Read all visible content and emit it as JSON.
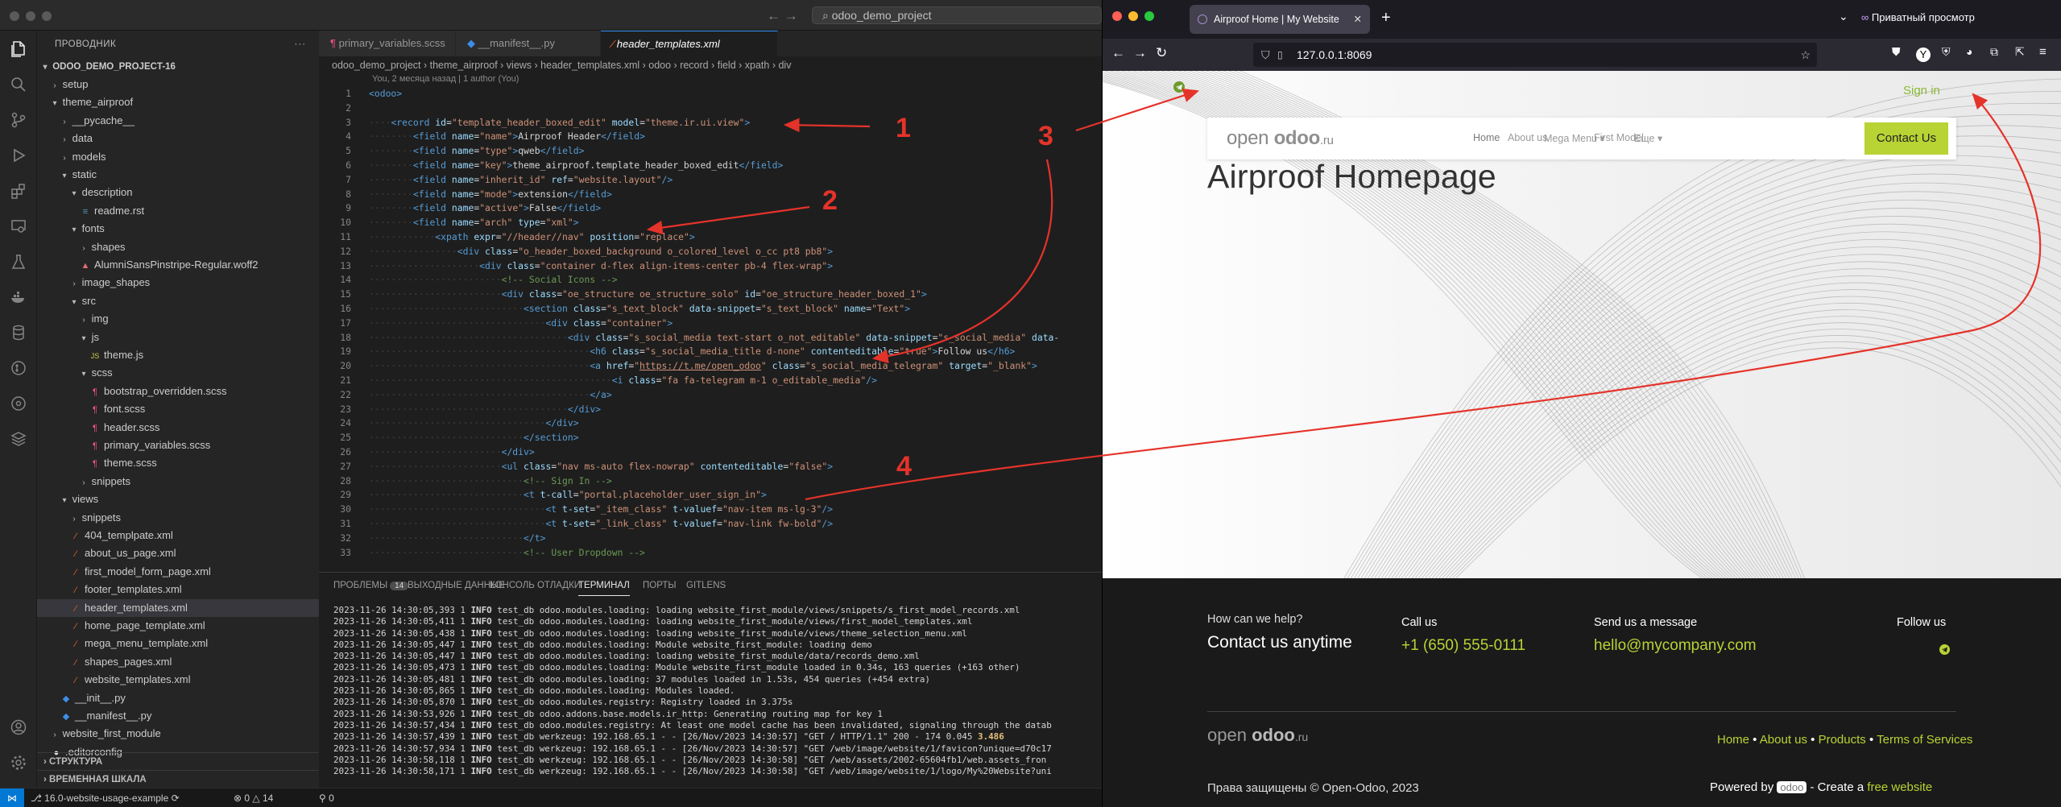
{
  "vscode": {
    "nav_arrows": "← →",
    "search_text": "odoo_demo_project",
    "explorer_title": "ПРОВОДНИК",
    "project": "ODOO_DEMO_PROJECT-16",
    "tree": [
      {
        "label": "setup",
        "indent": 1,
        "kind": "folder",
        "open": false
      },
      {
        "label": "theme_airproof",
        "indent": 1,
        "kind": "folder",
        "open": true
      },
      {
        "label": "__pycache__",
        "indent": 2,
        "kind": "folder",
        "open": false
      },
      {
        "label": "data",
        "indent": 2,
        "kind": "folder",
        "open": false
      },
      {
        "label": "models",
        "indent": 2,
        "kind": "folder",
        "open": false
      },
      {
        "label": "static",
        "indent": 2,
        "kind": "folder",
        "open": true
      },
      {
        "label": "description",
        "indent": 3,
        "kind": "folder",
        "open": true
      },
      {
        "label": "readme.rst",
        "indent": 4,
        "kind": "rst"
      },
      {
        "label": "fonts",
        "indent": 3,
        "kind": "folder",
        "open": true
      },
      {
        "label": "shapes",
        "indent": 4,
        "kind": "folder",
        "open": false
      },
      {
        "label": "AlumniSansPinstripe-Regular.woff2",
        "indent": 4,
        "kind": "font"
      },
      {
        "label": "image_shapes",
        "indent": 3,
        "kind": "folder",
        "open": false
      },
      {
        "label": "src",
        "indent": 3,
        "kind": "folder",
        "open": true
      },
      {
        "label": "img",
        "indent": 4,
        "kind": "folder",
        "open": false
      },
      {
        "label": "js",
        "indent": 4,
        "kind": "folder",
        "open": true
      },
      {
        "label": "theme.js",
        "indent": 5,
        "kind": "js"
      },
      {
        "label": "scss",
        "indent": 4,
        "kind": "folder",
        "open": true
      },
      {
        "label": "bootstrap_overridden.scss",
        "indent": 5,
        "kind": "scss"
      },
      {
        "label": "font.scss",
        "indent": 5,
        "kind": "scss"
      },
      {
        "label": "header.scss",
        "indent": 5,
        "kind": "scss"
      },
      {
        "label": "primary_variables.scss",
        "indent": 5,
        "kind": "scss"
      },
      {
        "label": "theme.scss",
        "indent": 5,
        "kind": "scss"
      },
      {
        "label": "snippets",
        "indent": 4,
        "kind": "folder",
        "open": false
      },
      {
        "label": "views",
        "indent": 2,
        "kind": "folder",
        "open": true
      },
      {
        "label": "snippets",
        "indent": 3,
        "kind": "folder",
        "open": false
      },
      {
        "label": "404_templpate.xml",
        "indent": 3,
        "kind": "xml"
      },
      {
        "label": "about_us_page.xml",
        "indent": 3,
        "kind": "xml"
      },
      {
        "label": "first_model_form_page.xml",
        "indent": 3,
        "kind": "xml"
      },
      {
        "label": "footer_templates.xml",
        "indent": 3,
        "kind": "xml"
      },
      {
        "label": "header_templates.xml",
        "indent": 3,
        "kind": "xml",
        "selected": true
      },
      {
        "label": "home_page_template.xml",
        "indent": 3,
        "kind": "xml"
      },
      {
        "label": "mega_menu_template.xml",
        "indent": 3,
        "kind": "xml"
      },
      {
        "label": "shapes_pages.xml",
        "indent": 3,
        "kind": "xml"
      },
      {
        "label": "website_templates.xml",
        "indent": 3,
        "kind": "xml"
      },
      {
        "label": "__init__.py",
        "indent": 2,
        "kind": "py"
      },
      {
        "label": "__manifest__.py",
        "indent": 2,
        "kind": "py"
      },
      {
        "label": "website_first_module",
        "indent": 1,
        "kind": "folder",
        "open": false
      },
      {
        "label": ".editorconfig",
        "indent": 1,
        "kind": "cfg"
      }
    ],
    "outline_label": "СТРУКТУРА",
    "timeline_label": "ВРЕМЕННАЯ ШКАЛА",
    "tabs": [
      {
        "label": "primary_variables.scss",
        "icon": "¶",
        "iconColor": "#f55385",
        "active": false
      },
      {
        "label": "__manifest__.py",
        "icon": "◆",
        "iconColor": "#3b8eea",
        "active": false
      },
      {
        "label": "header_templates.xml",
        "icon": "⁄",
        "iconColor": "#f1662a",
        "active": true
      }
    ],
    "breadcrumbs": [
      "odoo_demo_project",
      "theme_airproof",
      "views",
      "header_templates.xml",
      "odoo",
      "record",
      "field",
      "xpath",
      "div"
    ],
    "blame": "You, 2 месяца назад | 1 author (You)",
    "code": [
      {
        "n": "1",
        "d": 0,
        "h": "<span class=t>&lt;odoo&gt;</span>"
      },
      {
        "n": "2",
        "d": 0,
        "h": ""
      },
      {
        "n": "3",
        "d": 1,
        "h": "<span class=t>&lt;record</span> <span class=a>id</span><span class=w>=</span><span class=s>\"template_header_boxed_edit\"</span> <span class=a>model</span><span class=w>=</span><span class=s>\"theme.ir.ui.view\"</span><span class=t>&gt;</span>"
      },
      {
        "n": "4",
        "d": 2,
        "h": "<span class=t>&lt;field</span> <span class=a>name</span><span class=w>=</span><span class=s>\"name\"</span><span class=t>&gt;</span><span class=w>Airproof Header</span><span class=t>&lt;/field&gt;</span>"
      },
      {
        "n": "5",
        "d": 2,
        "h": "<span class=t>&lt;field</span> <span class=a>name</span><span class=w>=</span><span class=s>\"type\"</span><span class=t>&gt;</span><span class=w>qweb</span><span class=t>&lt;/field&gt;</span>"
      },
      {
        "n": "6",
        "d": 2,
        "h": "<span class=t>&lt;field</span> <span class=a>name</span><span class=w>=</span><span class=s>\"key\"</span><span class=t>&gt;</span><span class=w>theme_airproof.template_header_boxed_edit</span><span class=t>&lt;/field&gt;</span>"
      },
      {
        "n": "7",
        "d": 2,
        "h": "<span class=t>&lt;field</span> <span class=a>name</span><span class=w>=</span><span class=s>\"inherit_id\"</span> <span class=a>ref</span><span class=w>=</span><span class=s>\"website.layout\"</span><span class=t>/&gt;</span>"
      },
      {
        "n": "8",
        "d": 2,
        "h": "<span class=t>&lt;field</span> <span class=a>name</span><span class=w>=</span><span class=s>\"mode\"</span><span class=t>&gt;</span><span class=w>extension</span><span class=t>&lt;/field&gt;</span>"
      },
      {
        "n": "9",
        "d": 2,
        "h": "<span class=t>&lt;field</span> <span class=a>name</span><span class=w>=</span><span class=s>\"active\"</span><span class=t>&gt;</span><span class=w>False</span><span class=t>&lt;/field&gt;</span>"
      },
      {
        "n": "10",
        "d": 2,
        "h": "<span class=t>&lt;field</span> <span class=a>name</span><span class=w>=</span><span class=s>\"arch\"</span> <span class=a>type</span><span class=w>=</span><span class=s>\"xml\"</span><span class=t>&gt;</span>"
      },
      {
        "n": "11",
        "d": 3,
        "h": "<span class=t>&lt;xpath</span> <span class=a>expr</span><span class=w>=</span><span class=s>\"//header//nav\"</span> <span class=a>position</span><span class=w>=</span><span class=s>\"replace\"</span><span class=t>&gt;</span>"
      },
      {
        "n": "12",
        "d": 4,
        "h": "<span class=t>&lt;div</span> <span class=a>class</span><span class=w>=</span><span class=s>\"o_header_boxed_background o_colored_level o_cc pt8 pb8\"</span><span class=t>&gt;</span>"
      },
      {
        "n": "13",
        "d": 5,
        "h": "<span class=t>&lt;div</span> <span class=a>class</span><span class=w>=</span><span class=s>\"container d-flex align-items-center pb-4 flex-wrap\"</span><span class=t>&gt;</span>"
      },
      {
        "n": "14",
        "d": 6,
        "h": "<span class=c>&lt;!-- Social Icons --&gt;</span>"
      },
      {
        "n": "15",
        "d": 6,
        "h": "<span class=t>&lt;div</span> <span class=a>class</span><span class=w>=</span><span class=s>\"oe_structure oe_structure_solo\"</span> <span class=a>id</span><span class=w>=</span><span class=s>\"oe_structure_header_boxed_1\"</span><span class=t>&gt;</span>"
      },
      {
        "n": "16",
        "d": 7,
        "h": "<span class=t>&lt;section</span> <span class=a>class</span><span class=w>=</span><span class=s>\"s_text_block\"</span> <span class=a>data-snippet</span><span class=w>=</span><span class=s>\"s_text_block\"</span> <span class=a>name</span><span class=w>=</span><span class=s>\"Text\"</span><span class=t>&gt;</span>"
      },
      {
        "n": "17",
        "d": 8,
        "h": "<span class=t>&lt;div</span> <span class=a>class</span><span class=w>=</span><span class=s>\"container\"</span><span class=t>&gt;</span>"
      },
      {
        "n": "18",
        "d": 9,
        "h": "<span class=t>&lt;div</span> <span class=a>class</span><span class=w>=</span><span class=s>\"s_social_media text-start o_not_editable\"</span> <span class=a>data-snippet</span><span class=w>=</span><span class=s>\"s_social_media\"</span> <span class=a>data-</span>"
      },
      {
        "n": "19",
        "d": 10,
        "h": "<span class=t>&lt;h6</span> <span class=a>class</span><span class=w>=</span><span class=s>\"s_social_media_title d-none\"</span> <span class=a>contenteditable</span><span class=w>=</span><span class=s>\"true\"</span><span class=t>&gt;</span><span class=w>Follow us</span><span class=t>&lt;/h6&gt;</span>"
      },
      {
        "n": "20",
        "d": 10,
        "h": "<span class=t>&lt;a</span> <span class=a>href</span><span class=w>=</span><span class=s>\"<u>https://t.me/open_odoo</u>\"</span> <span class=a>class</span><span class=w>=</span><span class=s>\"s_social_media_telegram\"</span> <span class=a>target</span><span class=w>=</span><span class=s>\"_blank\"</span><span class=t>&gt;</span>"
      },
      {
        "n": "21",
        "d": 11,
        "h": "<span class=t>&lt;i</span> <span class=a>class</span><span class=w>=</span><span class=s>\"fa fa-telegram m-1 o_editable_media\"</span><span class=t>/&gt;</span>"
      },
      {
        "n": "22",
        "d": 10,
        "h": "<span class=t>&lt;/a&gt;</span>"
      },
      {
        "n": "23",
        "d": 9,
        "h": "<span class=t>&lt;/div&gt;</span>"
      },
      {
        "n": "24",
        "d": 8,
        "h": "<span class=t>&lt;/div&gt;</span>"
      },
      {
        "n": "25",
        "d": 7,
        "h": "<span class=t>&lt;/section&gt;</span>"
      },
      {
        "n": "26",
        "d": 6,
        "h": "<span class=t>&lt;/div&gt;</span>"
      },
      {
        "n": "27",
        "d": 6,
        "h": "<span class=t>&lt;ul</span> <span class=a>class</span><span class=w>=</span><span class=s>\"nav ms-auto flex-nowrap\"</span> <span class=a>contenteditable</span><span class=w>=</span><span class=s>\"false\"</span><span class=t>&gt;</span>"
      },
      {
        "n": "28",
        "d": 7,
        "h": "<span class=c>&lt;!-- Sign In --&gt;</span>"
      },
      {
        "n": "29",
        "d": 7,
        "h": "<span class=t>&lt;t</span> <span class=a>t-call</span><span class=w>=</span><span class=s>\"portal.placeholder_user_sign_in\"</span><span class=t>&gt;</span>"
      },
      {
        "n": "30",
        "d": 8,
        "h": "<span class=t>&lt;t</span> <span class=a>t-set</span><span class=w>=</span><span class=s>\"_item_class\"</span> <span class=a>t-valuef</span><span class=w>=</span><span class=s>\"nav-item ms-lg-3\"</span><span class=t>/&gt;</span>"
      },
      {
        "n": "31",
        "d": 8,
        "h": "<span class=t>&lt;t</span> <span class=a>t-set</span><span class=w>=</span><span class=s>\"_link_class\"</span> <span class=a>t-valuef</span><span class=w>=</span><span class=s>\"nav-link fw-bold\"</span><span class=t>/&gt;</span>"
      },
      {
        "n": "32",
        "d": 7,
        "h": "<span class=t>&lt;/t&gt;</span>"
      },
      {
        "n": "33",
        "d": 7,
        "h": "<span class=c>&lt;!-- User Dropdown --&gt;</span>"
      }
    ],
    "panel_tabs": [
      "ПРОБЛЕМЫ",
      "ВЫХОДНЫЕ ДАННЫЕ",
      "КОНСОЛЬ ОТЛАДКИ",
      "ТЕРМИНАЛ",
      "ПОРТЫ",
      "GITLENS"
    ],
    "problems_count": "14",
    "terminal": [
      {
        "ts": "2023-11-26 14:30:05,393",
        "pid": "1",
        "lvl": "INFO",
        "msg": "test_db odoo.modules.loading: loading website_first_module/views/snippets/s_first_model_records.xml"
      },
      {
        "ts": "2023-11-26 14:30:05,411",
        "pid": "1",
        "lvl": "INFO",
        "msg": "test_db odoo.modules.loading: loading website_first_module/views/first_model_templates.xml"
      },
      {
        "ts": "2023-11-26 14:30:05,438",
        "pid": "1",
        "lvl": "INFO",
        "msg": "test_db odoo.modules.loading: loading website_first_module/views/theme_selection_menu.xml"
      },
      {
        "ts": "2023-11-26 14:30:05,447",
        "pid": "1",
        "lvl": "INFO",
        "msg": "test_db odoo.modules.loading: Module website_first_module: loading demo"
      },
      {
        "ts": "2023-11-26 14:30:05,447",
        "pid": "1",
        "lvl": "INFO",
        "msg": "test_db odoo.modules.loading: loading website_first_module/data/records_demo.xml"
      },
      {
        "ts": "2023-11-26 14:30:05,473",
        "pid": "1",
        "lvl": "INFO",
        "msg": "test_db odoo.modules.loading: Module website_first_module loaded in 0.34s, 163 queries (+163 other)"
      },
      {
        "ts": "2023-11-26 14:30:05,481",
        "pid": "1",
        "lvl": "INFO",
        "msg": "test_db odoo.modules.loading: 37 modules loaded in 1.53s, 454 queries (+454 extra)"
      },
      {
        "ts": "2023-11-26 14:30:05,865",
        "pid": "1",
        "lvl": "INFO",
        "msg": "test_db odoo.modules.loading: Modules loaded."
      },
      {
        "ts": "2023-11-26 14:30:05,870",
        "pid": "1",
        "lvl": "INFO",
        "msg": "test_db odoo.modules.registry: Registry loaded in 3.375s"
      },
      {
        "ts": "2023-11-26 14:30:53,926",
        "pid": "1",
        "lvl": "INFO",
        "msg": "test_db odoo.addons.base.models.ir_http: Generating routing map for key 1"
      },
      {
        "ts": "2023-11-26 14:30:57,434",
        "pid": "1",
        "lvl": "INFO",
        "msg": "test_db odoo.modules.registry: At least one model cache has been invalidated, signaling through the datab"
      },
      {
        "ts": "2023-11-26 14:30:57,439",
        "pid": "1",
        "lvl": "INFO",
        "msg": "test_db werkzeug: 192.168.65.1 - - [26/Nov/2023 14:30:57] \"GET / HTTP/1.1\" 200 - ",
        "tail": [
          "174",
          "0.045",
          "3.486"
        ]
      },
      {
        "ts": "2023-11-26 14:30:57,934",
        "pid": "1",
        "lvl": "INFO",
        "msg": "test_db werkzeug: 192.168.65.1 - - [26/Nov/2023 14:30:57] \"GET /web/image/website/1/favicon?unique=d70c17"
      },
      {
        "ts": "2023-11-26 14:30:58,118",
        "pid": "1",
        "lvl": "INFO",
        "msg": "test_db werkzeug: 192.168.65.1 - - [26/Nov/2023 14:30:58] \"GET /web/assets/2002-65604fb1/web.assets_fron"
      },
      {
        "ts": "2023-11-26 14:30:58,171",
        "pid": "1",
        "lvl": "INFO",
        "msg": "test_db werkzeug: 192.168.65.1 - - [26/Nov/2023 14:30:58] \"GET /web/image/website/1/logo/My%20Website?uni"
      }
    ],
    "status": {
      "branch": "16.0-website-usage-example",
      "sync": "⟳",
      "errors": "0",
      "warnings": "14",
      "ports": "0"
    }
  },
  "firefox": {
    "tab_title": "Airproof Home | My Website",
    "private_label": "Приватный просмотр",
    "url": "127.0.0.1:8069",
    "site": {
      "signin": "Sign in",
      "logo_a": "open ",
      "logo_b": "odoo",
      "logo_c": ".ru",
      "menu": [
        "Home",
        "About us",
        "Mega Menu ▾",
        "First Model",
        "Еще ▾"
      ],
      "cta": "Contact Us",
      "title": "Airproof Homepage",
      "help_label": "How can we help?",
      "help_big": "Contact us anytime",
      "call_label": "Call us",
      "phone": "+1 (650) 555-0111",
      "msg_label": "Send us a message",
      "email": "hello@mycompany.com",
      "follow_label": "Follow us",
      "footer_links": [
        "Home",
        "About us",
        "Products",
        "Terms of Services"
      ],
      "copyright": "Права защищены © Open-Odoo, 2023",
      "powered_a": "Powered by ",
      "powered_logo": "odoo",
      "powered_b": " - Create a ",
      "powered_c": "free website"
    }
  },
  "annotations": {
    "labels": [
      "1",
      "2",
      "3",
      "4"
    ],
    "color": "#e5332a"
  },
  "colors": {
    "accent_green": "#b8d334",
    "vscode_blue": "#0078d4"
  }
}
